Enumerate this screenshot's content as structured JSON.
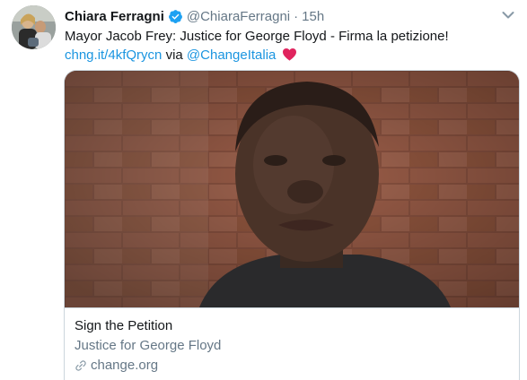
{
  "author": {
    "name": "Chiara Ferragni",
    "handle": "@ChiaraFerragni",
    "separator": "·",
    "time": "15h",
    "verified": true
  },
  "tweet": {
    "text_line1": "Mayor Jacob Frey: Justice for George Floyd - Firma la petizione!",
    "link_url": "chng.it/4kfQrycn",
    "via": "via",
    "mention": "@ChangeItalia",
    "emoji": "red-heart-icon"
  },
  "card": {
    "title": "Sign the Petition",
    "description": "Justice for George Floyd",
    "domain": "change.org"
  },
  "colors": {
    "link": "#1b95e0",
    "secondary_text": "#657786",
    "primary_text": "#14171a",
    "verified": "#1da1f2",
    "heart": "#e0245e",
    "border": "#ccd6dd"
  }
}
